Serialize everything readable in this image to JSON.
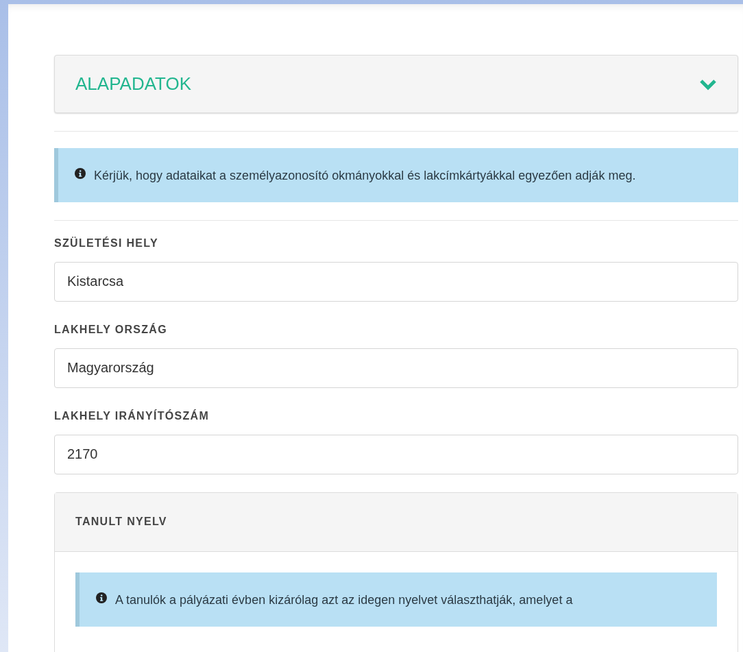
{
  "section": {
    "title": "ALAPADATOK"
  },
  "notice": "Kérjük, hogy adataikat a személyazonosító okmányokkal és lakcímkártyákkal egyezően adják meg.",
  "fields": [
    {
      "label": "SZÜLETÉSI HELY",
      "value": "Kistarcsa"
    },
    {
      "label": "LAKHELY ORSZÁG",
      "value": "Magyarország"
    },
    {
      "label": "LAKHELY IRÁNYÍTÓSZÁM",
      "value": "2170"
    }
  ],
  "panel": {
    "title": "TANULT NYELV",
    "notice": "A tanulók a pályázati évben kizárólag azt az idegen nyelvet választhatják, amelyet a"
  }
}
